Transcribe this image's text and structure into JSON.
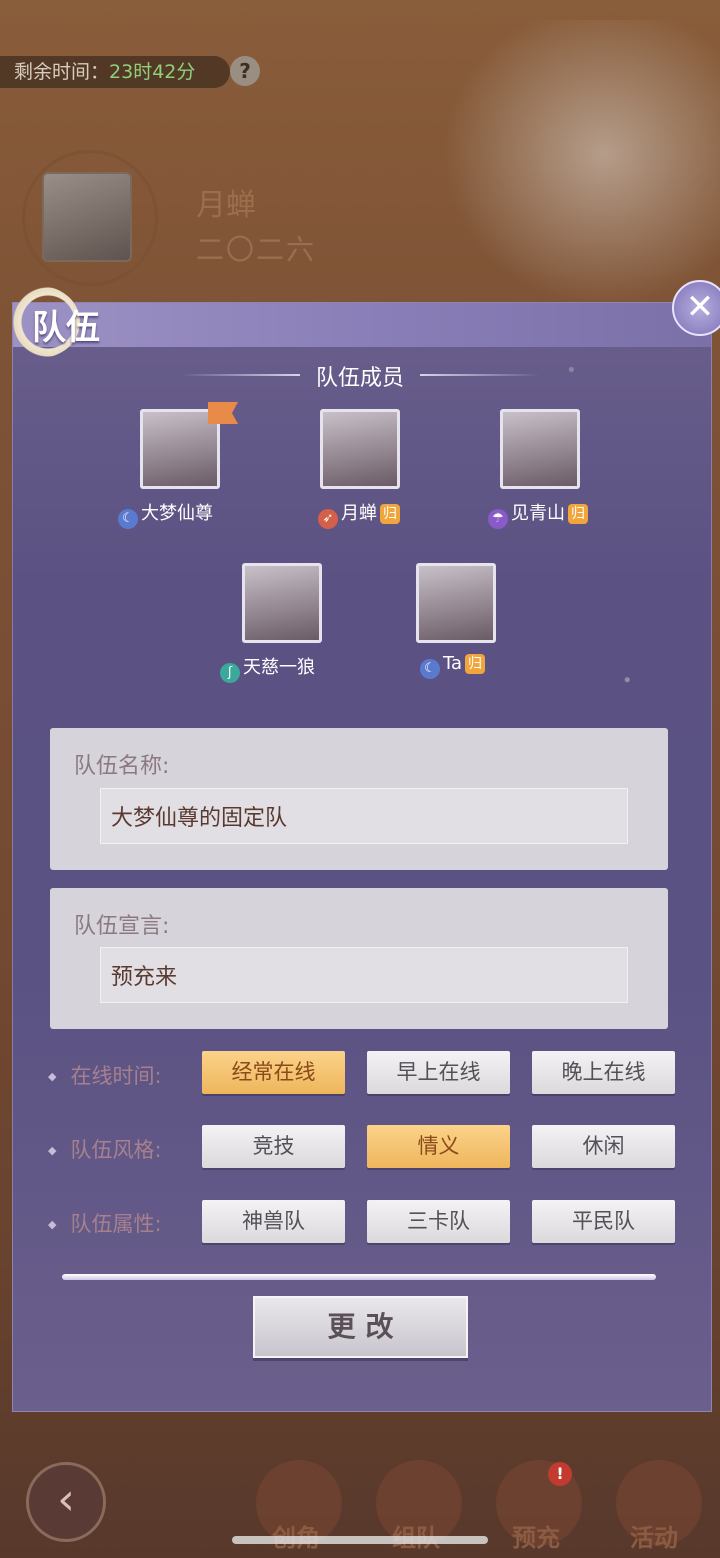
{
  "background": {
    "timer_label": "剩余时间：",
    "timer_value": "23时42分",
    "help_icon": "question-mark-icon",
    "player_name": "月蝉",
    "player_subtitle": "二〇二六",
    "nav": {
      "back_icon": "back-arrow-icon",
      "items": [
        {
          "label": "创角"
        },
        {
          "label": "组队"
        },
        {
          "label": "预充"
        },
        {
          "label": "活动"
        }
      ],
      "alert_badge": "!"
    }
  },
  "panel": {
    "title": "队伍",
    "close_icon": "close-x-icon",
    "members_title": "队伍成员",
    "members": [
      {
        "name": "大梦仙尊",
        "class_icon": "moon-class-icon",
        "leader": true,
        "returning": false
      },
      {
        "name": "月蝉",
        "class_icon": "arrow-class-icon",
        "leader": false,
        "returning": true
      },
      {
        "name": "见青山",
        "class_icon": "umbrella-class-icon",
        "leader": false,
        "returning": true
      },
      {
        "name": "天慈一狼",
        "class_icon": "feather-class-icon",
        "leader": false,
        "returning": false
      },
      {
        "name": "Ta",
        "class_icon": "moon-class-icon",
        "leader": false,
        "returning": true
      }
    ],
    "returning_tag": "归",
    "team_name_label": "队伍名称:",
    "team_name_value": "大梦仙尊的固定队",
    "team_motto_label": "队伍宣言:",
    "team_motto_value": "预充来",
    "online_time": {
      "label": "在线时间:",
      "options": [
        "经常在线",
        "早上在线",
        "晚上在线"
      ],
      "selected": "经常在线"
    },
    "team_style": {
      "label": "队伍风格:",
      "options": [
        "竞技",
        "情义",
        "休闲"
      ],
      "selected": "情义"
    },
    "team_attr": {
      "label": "队伍属性:",
      "options": [
        "神兽队",
        "三卡队",
        "平民队"
      ],
      "selected": null
    },
    "change_button": "更改"
  },
  "colors": {
    "panel_bg": "#5b5283",
    "selected_option": "#f2bf6a",
    "return_tag": "#f1a53a",
    "leader_flag": "#e88a48"
  }
}
